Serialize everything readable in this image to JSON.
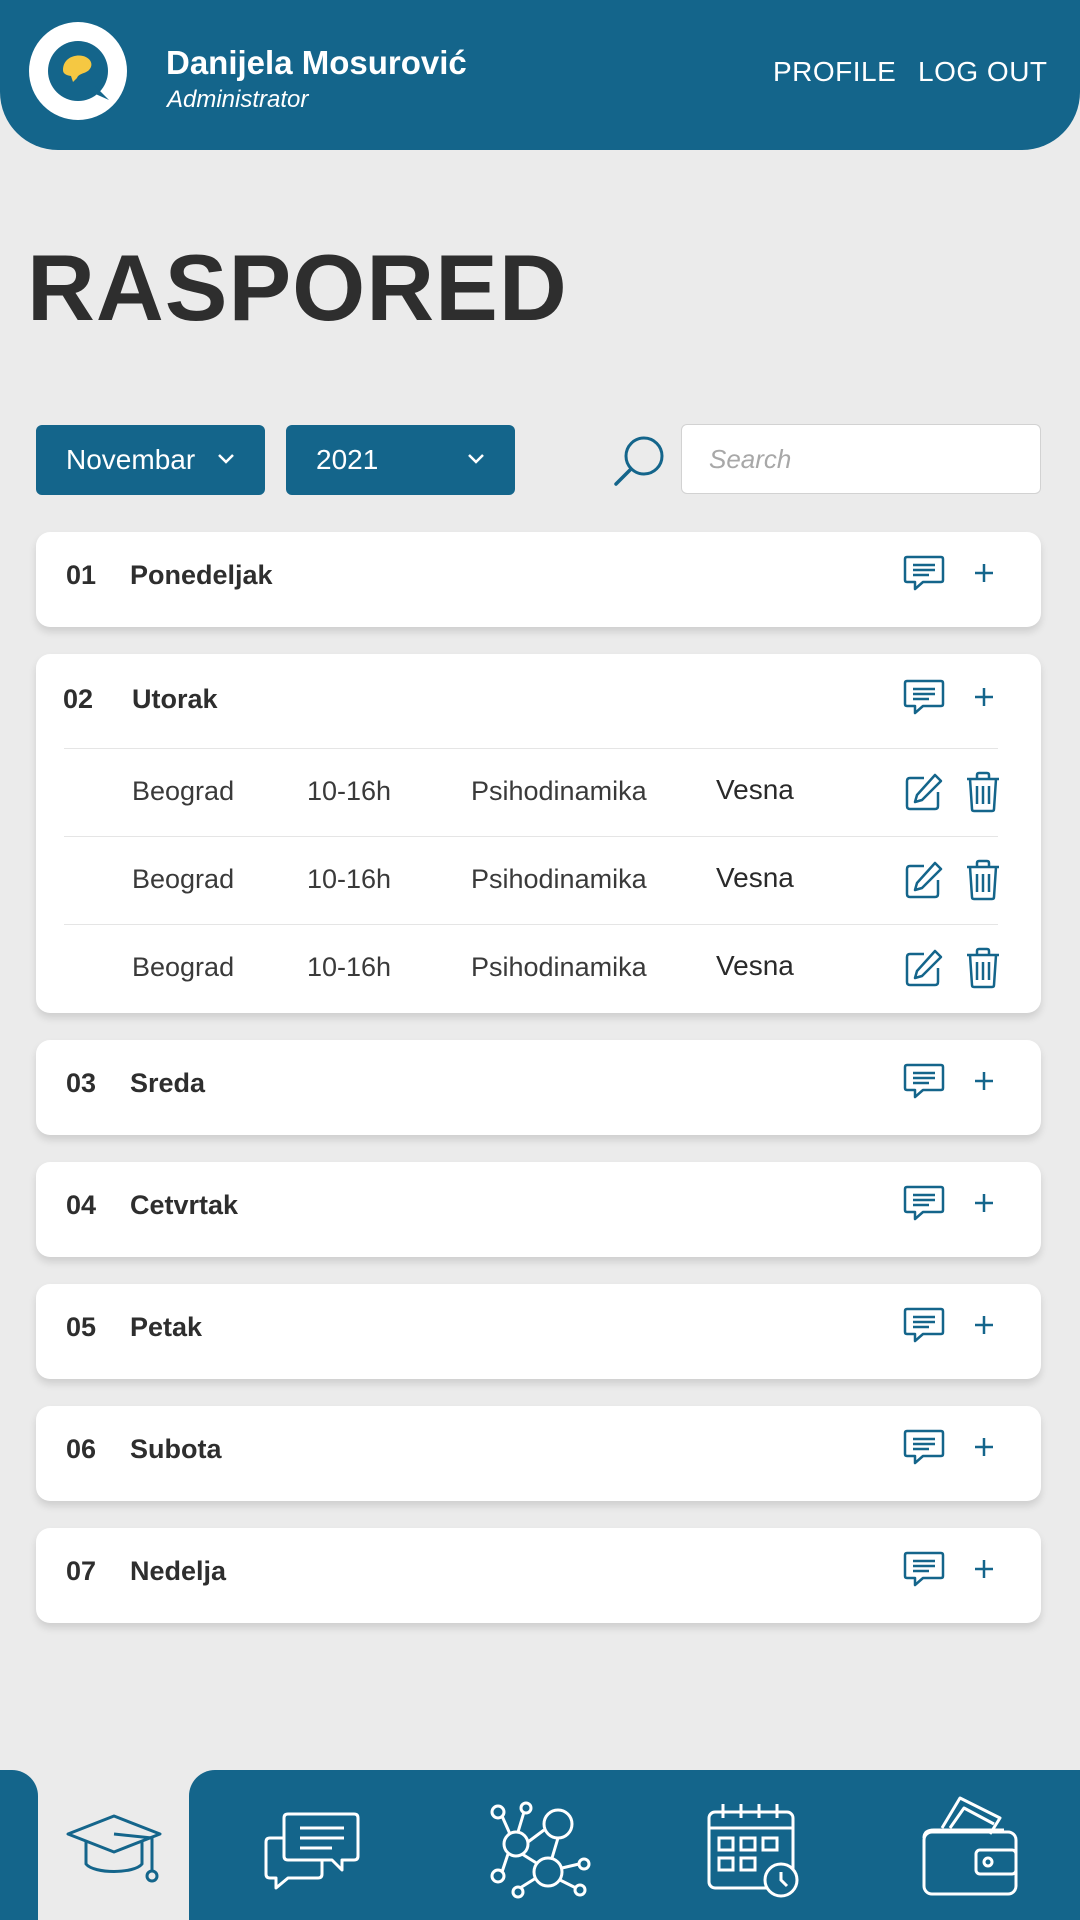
{
  "header": {
    "user_name": "Danijela Mosurović",
    "user_role": "Administrator",
    "nav": {
      "profile": "PROFILE",
      "logout": "LOG OUT"
    },
    "logo_icon": "speech-bubble-logo"
  },
  "page": {
    "title": "RASPORED"
  },
  "filters": {
    "month": "Novembar",
    "year": "2021",
    "search_placeholder": "Search",
    "search_value": ""
  },
  "days": [
    {
      "num": "01",
      "name": "Ponedeljak",
      "entries": []
    },
    {
      "num": "02",
      "name": "Utorak",
      "entries": [
        {
          "city": "Beograd",
          "time": "10-16h",
          "course": "Psihodinamika",
          "person": "Vesna"
        },
        {
          "city": "Beograd",
          "time": "10-16h",
          "course": "Psihodinamika",
          "person": "Vesna"
        },
        {
          "city": "Beograd",
          "time": "10-16h",
          "course": "Psihodinamika",
          "person": "Vesna"
        }
      ]
    },
    {
      "num": "03",
      "name": "Sreda",
      "entries": []
    },
    {
      "num": "04",
      "name": "Cetvrtak",
      "entries": []
    },
    {
      "num": "05",
      "name": "Petak",
      "entries": []
    },
    {
      "num": "06",
      "name": "Subota",
      "entries": []
    },
    {
      "num": "07",
      "name": "Nedelja",
      "entries": []
    }
  ],
  "bottom_nav": {
    "active": "graduation-cap",
    "items": [
      "graduation-cap-icon",
      "chat-icon",
      "network-icon",
      "calendar-icon",
      "wallet-icon"
    ]
  },
  "colors": {
    "primary": "#14658b",
    "background": "#ebebeb",
    "card": "#ffffff",
    "text": "#2e2e2e",
    "logo_accent": "#f5c842"
  }
}
